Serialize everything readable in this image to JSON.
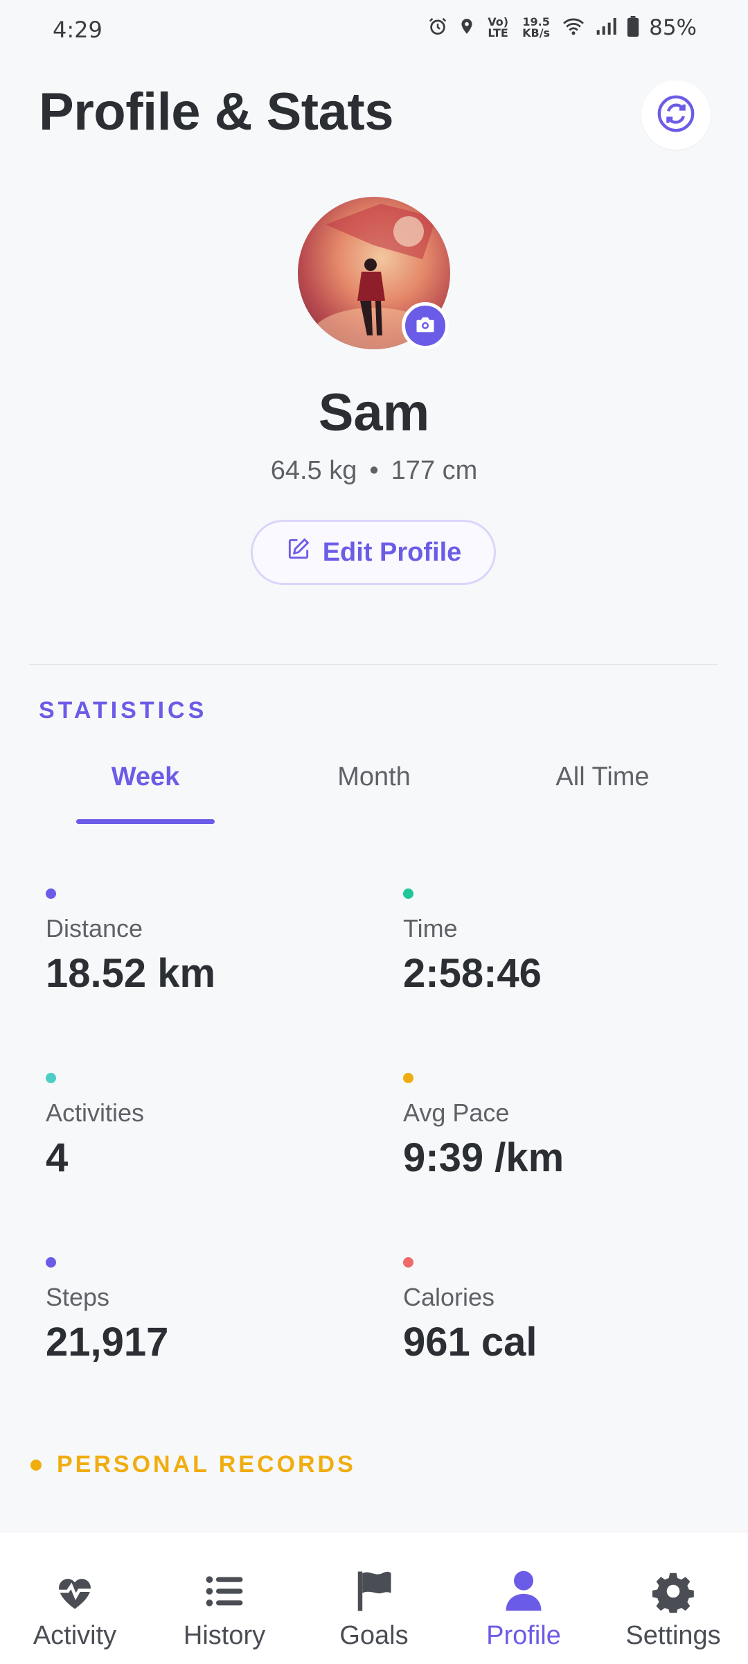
{
  "status_bar": {
    "time": "4:29",
    "volte": "Vo) LTE",
    "network_speed": "19.5 KB/s",
    "battery": "85%"
  },
  "header": {
    "title": "Profile & Stats",
    "refresh_icon": "refresh-icon"
  },
  "profile": {
    "name": "Sam",
    "weight": "64.5 kg",
    "separator": "•",
    "height": "177 cm",
    "edit_label": "Edit Profile"
  },
  "statistics": {
    "label": "STATISTICS",
    "tabs": [
      {
        "label": "Week",
        "active": true
      },
      {
        "label": "Month",
        "active": false
      },
      {
        "label": "All Time",
        "active": false
      }
    ],
    "items": [
      {
        "label": "Distance",
        "value": "18.52 km",
        "color": "#6b5ce7"
      },
      {
        "label": "Time",
        "value": "2:58:46",
        "color": "#1fc79a"
      },
      {
        "label": "Activities",
        "value": "4",
        "color": "#4ecdc4"
      },
      {
        "label": "Avg Pace",
        "value": "9:39 /km",
        "color": "#f0ad10"
      },
      {
        "label": "Steps",
        "value": "21,917",
        "color": "#6b5ce7"
      },
      {
        "label": "Calories",
        "value": "961 cal",
        "color": "#f06a6a"
      }
    ]
  },
  "personal_records": {
    "label": "PERSONAL RECORDS",
    "color": "#f0ad10"
  },
  "bottom_nav": {
    "items": [
      {
        "label": "Activity",
        "icon": "heart-pulse-icon",
        "active": false
      },
      {
        "label": "History",
        "icon": "list-icon",
        "active": false
      },
      {
        "label": "Goals",
        "icon": "flag-icon",
        "active": false
      },
      {
        "label": "Profile",
        "icon": "person-icon",
        "active": true
      },
      {
        "label": "Settings",
        "icon": "gear-icon",
        "active": false
      }
    ]
  },
  "colors": {
    "accent": "#6b5ce7",
    "text": "#2b2f33",
    "muted": "#5e6267",
    "background": "#f7f8fa"
  }
}
